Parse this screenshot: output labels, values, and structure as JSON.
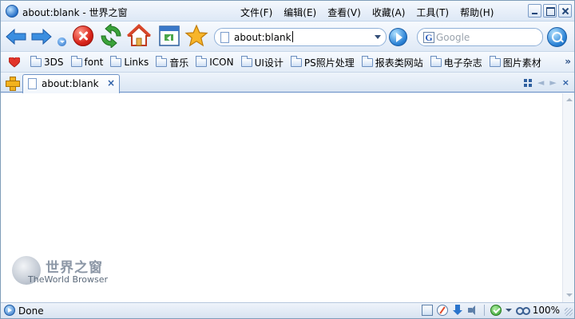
{
  "window": {
    "title": "about:blank - 世界之窗"
  },
  "menu": {
    "items": [
      {
        "label": "文件(F)"
      },
      {
        "label": "编辑(E)"
      },
      {
        "label": "查看(V)"
      },
      {
        "label": "收藏(A)"
      },
      {
        "label": "工具(T)"
      },
      {
        "label": "帮助(H)"
      }
    ]
  },
  "toolbar": {
    "icons": [
      "back-arrow-icon",
      "forward-arrow-icon",
      "dropdown-icon",
      "stop-icon",
      "refresh-icon",
      "home-icon",
      "feed-icon",
      "favorites-star-icon"
    ],
    "address": "about:blank",
    "search_placeholder": "Google"
  },
  "bookmarks": {
    "items": [
      {
        "label": "3DS"
      },
      {
        "label": "font"
      },
      {
        "label": "Links"
      },
      {
        "label": "音乐"
      },
      {
        "label": "ICON"
      },
      {
        "label": "UI设计"
      },
      {
        "label": "PS照片处理"
      },
      {
        "label": "报表类网站"
      },
      {
        "label": "电子杂志"
      },
      {
        "label": "图片素材"
      }
    ],
    "more": "»"
  },
  "tabs": {
    "items": [
      {
        "label": "about:blank",
        "close": "×"
      }
    ],
    "close_all": "×"
  },
  "content": {
    "watermark_cn": "世界之窗",
    "watermark_en": "TheWorld Browser"
  },
  "status": {
    "text": "Done",
    "zoom": "100%"
  },
  "colors": {
    "accent": "#2a73c9",
    "chrome_bg": "#dfe9f5",
    "stop_red": "#d9241a",
    "refresh_green": "#3aa33a",
    "star_orange": "#f2a516"
  }
}
